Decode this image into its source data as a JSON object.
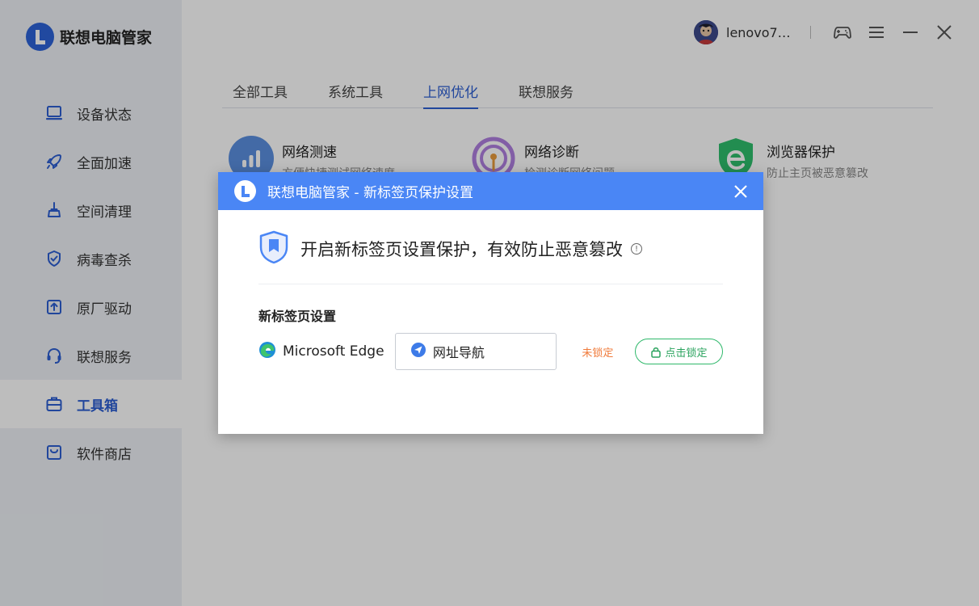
{
  "app": {
    "name": "联想电脑管家"
  },
  "sidebar": {
    "items": [
      {
        "label": "设备状态",
        "icon": "laptop-icon"
      },
      {
        "label": "全面加速",
        "icon": "rocket-icon"
      },
      {
        "label": "空间清理",
        "icon": "broom-icon"
      },
      {
        "label": "病毒查杀",
        "icon": "shield-check-icon"
      },
      {
        "label": "原厂驱动",
        "icon": "driver-upload-icon"
      },
      {
        "label": "联想服务",
        "icon": "headset-icon"
      },
      {
        "label": "工具箱",
        "icon": "toolbox-icon",
        "active": true
      },
      {
        "label": "软件商店",
        "icon": "store-icon"
      }
    ]
  },
  "topbar": {
    "username": "lenovo7…"
  },
  "tabs": [
    {
      "label": "全部工具"
    },
    {
      "label": "系统工具"
    },
    {
      "label": "上网优化",
      "active": true
    },
    {
      "label": "联想服务"
    }
  ],
  "tools": [
    {
      "title": "网络测速",
      "desc": "方便快捷测试网络速度",
      "color": "#5b8fe0"
    },
    {
      "title": "网络诊断",
      "desc": "检测诊断网络问题",
      "color": "#b07fe0"
    },
    {
      "title": "浏览器保护",
      "desc": "防止主页被恶意篡改",
      "color": "#2fbf6c"
    }
  ],
  "dialog": {
    "title": "联想电脑管家 - 新标签页保护设置",
    "banner": "开启新标签页设置保护，有效防止恶意篡改",
    "section_title": "新标签页设置",
    "browser_name": "Microsoft Edge",
    "selected_option": "网址导航",
    "lock_status": "未锁定",
    "lock_button": "点击锁定"
  },
  "colors": {
    "accent": "#2d5fd3",
    "dialog_header": "#4a86f5",
    "unlocked": "#f07a3a",
    "lock_button": "#2eb86a"
  }
}
